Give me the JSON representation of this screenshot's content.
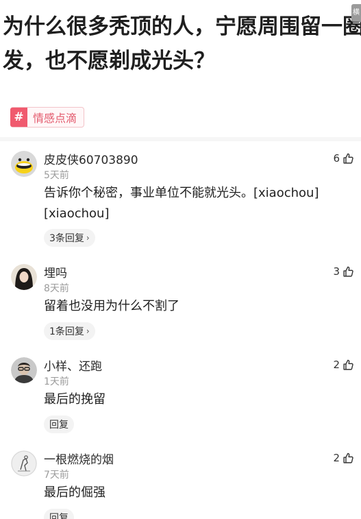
{
  "post": {
    "title": "为什么很多秃顶的人，宁愿周围留一圈头发，也不愿剃成光头？",
    "corner_badge": "横",
    "topic_tag": "情感点滴",
    "topic_icon": "#"
  },
  "comments": [
    {
      "user": "皮皮侠60703890",
      "time": "5天前",
      "likes": "6",
      "text": "告诉你个秘密，事业单位不能就光头。[xiaochou][xiaochou]",
      "reply_label": "3条回复",
      "avatar_icon": "yellow-duck-avatar"
    },
    {
      "user": "埋吗",
      "time": "8天前",
      "likes": "3",
      "text": "留着也没用为什么不割了",
      "reply_label": "1条回复",
      "avatar_icon": "long-hair-girl-avatar"
    },
    {
      "user": "小样、还跑",
      "time": "1天前",
      "likes": "2",
      "text": "最后的挽留",
      "reply_label": "回复",
      "avatar_icon": "glasses-man-avatar"
    },
    {
      "user": "一根燃烧的烟",
      "time": "7天前",
      "likes": "2",
      "text": "最后的倔强",
      "reply_label": "回复",
      "avatar_icon": "sketch-avatar"
    }
  ],
  "colors": {
    "accent": "#f05a6e",
    "tag_text": "#e35a6d",
    "meta_text": "#9b9b9b"
  }
}
